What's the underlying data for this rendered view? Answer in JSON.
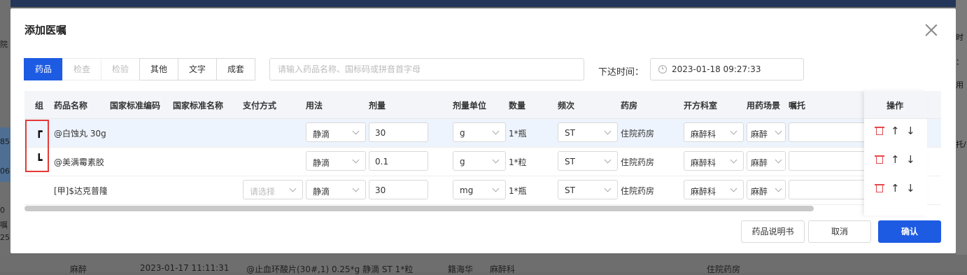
{
  "dialog": {
    "title": "添加医嘱",
    "tabs": [
      {
        "label": "药品",
        "state": "active"
      },
      {
        "label": "检查",
        "state": "disabled"
      },
      {
        "label": "检验",
        "state": "disabled"
      },
      {
        "label": "其他",
        "state": "normal"
      },
      {
        "label": "文字",
        "state": "normal"
      },
      {
        "label": "成套",
        "state": "normal"
      }
    ],
    "search_placeholder": "请输入药品名称、国标码或拼音首字母",
    "issue_time_label": "下达时间：",
    "issue_time_value": "2023-01-18 09:27:33",
    "columns": {
      "group": "组",
      "drug_name": "药品名称",
      "nat_code": "国家标准编码",
      "nat_name": "国家标准名称",
      "payment": "支付方式",
      "usage": "用法",
      "dose": "剂量",
      "dose_unit": "剂量单位",
      "quantity": "数量",
      "frequency": "频次",
      "pharmacy": "药房",
      "department": "开方科室",
      "scene": "用药场景",
      "note": "嘱托",
      "ops": "操作"
    },
    "rows": [
      {
        "group_mark": "┏",
        "drug_name": "@白蚀丸 30g",
        "payment": "",
        "usage": "静滴",
        "dose": "30",
        "dose_unit": "g",
        "quantity": "1*瓶",
        "frequency": "ST",
        "pharmacy": "住院药房",
        "department": "麻醉科",
        "scene": "麻醉",
        "note": ""
      },
      {
        "group_mark": "┗",
        "drug_name": "@美满霉素胶",
        "payment": "",
        "usage": "静滴",
        "dose": "0.1",
        "dose_unit": "g",
        "quantity": "1*粒",
        "frequency": "ST",
        "pharmacy": "住院药房",
        "department": "麻醉科",
        "scene": "麻醉",
        "note": ""
      },
      {
        "group_mark": "",
        "drug_name": "[甲]$达克普隆",
        "payment": "请选择",
        "usage": "静滴",
        "dose": "30",
        "dose_unit": "mg",
        "quantity": "1*瓶",
        "frequency": "ST",
        "pharmacy": "住院药房",
        "department": "麻醉科",
        "scene": "麻醉",
        "note": ""
      }
    ],
    "buttons": {
      "instructions": "药品说明书",
      "cancel": "取消",
      "confirm": "确认"
    },
    "accent_color": "#1d5be3",
    "delete_icon_color": "#e5484d"
  },
  "background": {
    "bottom_row": [
      "麻醉",
      "2023-01-17 11:11:31",
      "@止血环酸片(30#,1) 0.25*g 静滴 ST 1*粒",
      "籍海华",
      "麻醉科",
      "住院药房"
    ],
    "left_fragments": [
      "院",
      "85",
      "06",
      "0",
      "嘱",
      "25"
    ],
    "right_fragments": [
      "时",
      "：",
      "用",
      "托/"
    ]
  }
}
